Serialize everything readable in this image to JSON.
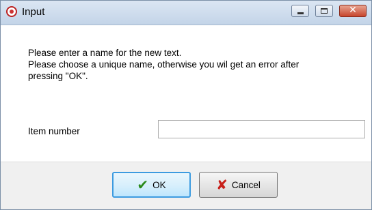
{
  "window": {
    "title": "Input",
    "icon": "app-logo-icon"
  },
  "message": {
    "line1": "Please enter a name for the new text.",
    "line2": "Please choose a unique name, otherwise you wil get an error after",
    "line3": "pressing \"OK\"."
  },
  "field": {
    "label": "Item number",
    "value": "",
    "placeholder": ""
  },
  "buttons": {
    "ok_label": "OK",
    "ok_icon": "checkmark-icon",
    "cancel_label": "Cancel",
    "cancel_icon": "x-icon"
  },
  "colors": {
    "ok_check": "#2a8a1a",
    "cancel_x": "#c8201a",
    "close_button": "#c7452c",
    "focus_border": "#3c9be0"
  }
}
